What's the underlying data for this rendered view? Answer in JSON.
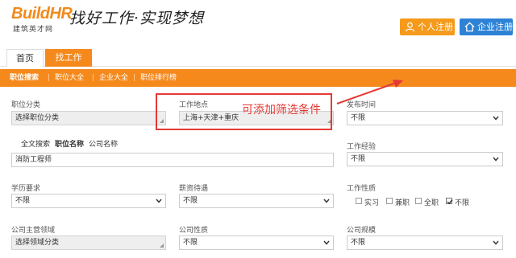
{
  "header": {
    "logo_text": "BuildHR",
    "logo_subtitle": "建筑英才网",
    "slogan": "找好工作·实现梦想",
    "personal_register": "个人注册",
    "company_register": "企业注册"
  },
  "tabs": [
    {
      "label": "首页",
      "active": false
    },
    {
      "label": "找工作",
      "active": true
    }
  ],
  "subnav": [
    "职位搜索",
    "职位大全",
    "企业大全",
    "职位排行榜"
  ],
  "form": {
    "job_category": {
      "label": "职位分类",
      "value": "选择职位分类"
    },
    "location": {
      "label": "工作地点",
      "value": "上海+天津+重庆"
    },
    "publish_time": {
      "label": "发布时间",
      "value": "不限"
    },
    "search_tabs": [
      "全文搜索",
      "职位名称",
      "公司名称"
    ],
    "keyword": "消防工程师",
    "experience": {
      "label": "工作经验",
      "value": "不限"
    },
    "education": {
      "label": "学历要求",
      "value": "不限"
    },
    "salary": {
      "label": "薪资待遇",
      "value": "不限"
    },
    "job_nature": {
      "label": "工作性质",
      "options": [
        {
          "label": "实习",
          "checked": false
        },
        {
          "label": "兼职",
          "checked": false
        },
        {
          "label": "全职",
          "checked": false
        },
        {
          "label": "不限",
          "checked": true
        }
      ]
    },
    "company_domain": {
      "label": "公司主营领域",
      "value": "选择领域分类"
    },
    "company_nature": {
      "label": "公司性质",
      "value": "不限"
    },
    "company_size": {
      "label": "公司规模",
      "value": "不限"
    }
  },
  "annotation": {
    "text": "可添加筛选条件",
    "color": "#e53935"
  },
  "colors": {
    "accent_orange": "#f5891c",
    "company_blue": "#2d82d6"
  }
}
